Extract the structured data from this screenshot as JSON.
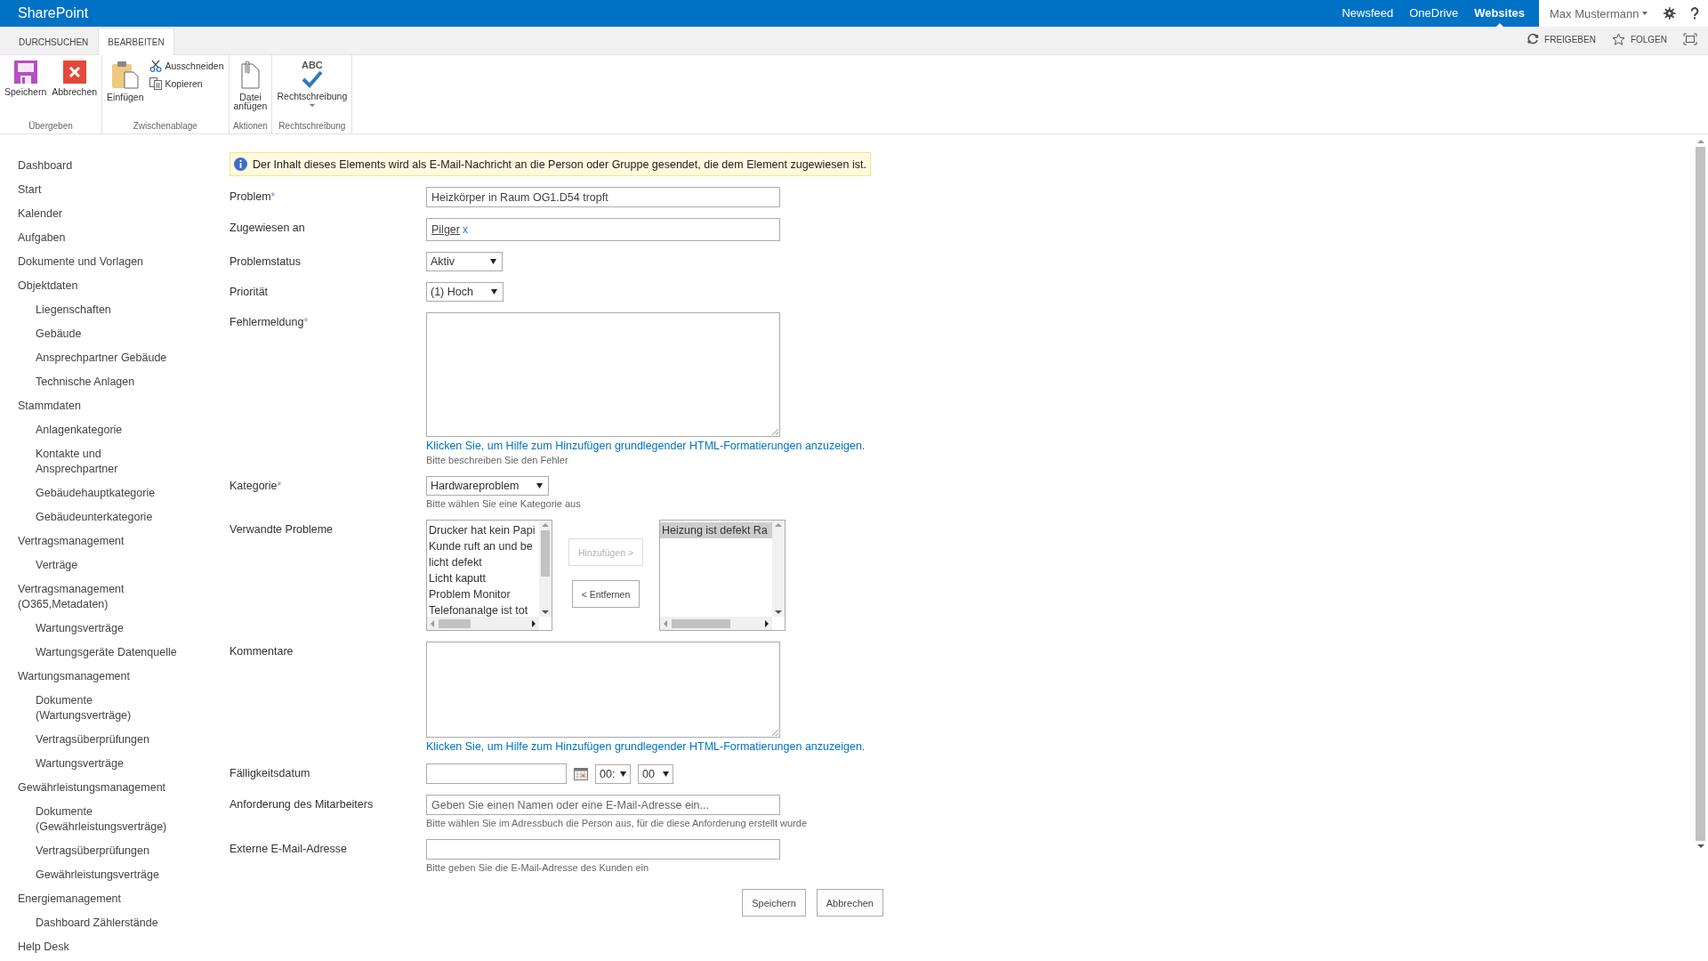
{
  "top_bar": {
    "brand": "SharePoint",
    "links": [
      {
        "label": "Newsfeed",
        "selected": false
      },
      {
        "label": "OneDrive",
        "selected": false
      },
      {
        "label": "Websites",
        "selected": true
      }
    ],
    "user": "Max Mustermann"
  },
  "ribbon": {
    "tabs": [
      {
        "label": "DURCHSUCHEN",
        "selected": false
      },
      {
        "label": "BEARBEITEN",
        "selected": true
      }
    ],
    "actions": [
      {
        "label": "FREIGEBEN",
        "kind": "share"
      },
      {
        "label": "FOLGEN",
        "kind": "follow"
      }
    ],
    "groups": [
      {
        "label": "Übergeben",
        "commands": [
          {
            "label": "Speichern",
            "kind": "save"
          },
          {
            "label": "Abbrechen",
            "kind": "cancel"
          }
        ]
      },
      {
        "label": "Zwischenablage",
        "commands": [
          {
            "label": "Einfügen",
            "kind": "paste"
          },
          {
            "label": "Ausschneiden",
            "kind": "cut"
          },
          {
            "label": "Kopieren",
            "kind": "copy"
          }
        ]
      },
      {
        "label": "Aktionen",
        "commands": [
          {
            "label": "Datei\nanfügen",
            "kind": "attach"
          }
        ]
      },
      {
        "label": "Rechtschreibung",
        "commands": [
          {
            "label": "Rechtschreibung",
            "kind": "spell",
            "icon_text": "ABC"
          }
        ]
      }
    ]
  },
  "nav": [
    {
      "label": "Dashboard"
    },
    {
      "label": "Start"
    },
    {
      "label": "Kalender"
    },
    {
      "label": "Aufgaben"
    },
    {
      "label": "Dokumente und Vorlagen"
    },
    {
      "label": "Objektdaten",
      "children": [
        {
          "label": "Liegenschaften"
        },
        {
          "label": "Gebäude"
        },
        {
          "label": "Ansprechpartner Gebäude"
        },
        {
          "label": "Technische Anlagen"
        }
      ]
    },
    {
      "label": "Stammdaten",
      "children": [
        {
          "label": "Anlagenkategorie"
        },
        {
          "label": "Kontakte und\nAnsprechpartner"
        },
        {
          "label": "Gebäudehauptkategorie"
        },
        {
          "label": "Gebäudeunterkategorie"
        }
      ]
    },
    {
      "label": "Vertragsmanagement",
      "children": [
        {
          "label": "Verträge"
        }
      ]
    },
    {
      "label": "Vertragsmanagement\n(O365,Metadaten)",
      "children": [
        {
          "label": "Wartungsverträge"
        },
        {
          "label": "Wartungsgeräte Datenquelle"
        }
      ]
    },
    {
      "label": "Wartungsmanagement",
      "children": [
        {
          "label": "Dokumente\n(Wartungsverträge)"
        },
        {
          "label": "Vertragsüberprüfungen"
        },
        {
          "label": "Wartungsverträge"
        }
      ]
    },
    {
      "label": "Gewährleistungsmanagement",
      "children": [
        {
          "label": "Dokumente\n(Gewährleistungsverträge)"
        },
        {
          "label": "Vertragsüberprüfungen"
        },
        {
          "label": "Gewährleistungsverträge"
        }
      ]
    },
    {
      "label": "Energiemanagement",
      "children": [
        {
          "label": "Dashboard Zählerstände"
        }
      ]
    },
    {
      "label": "Help Desk"
    }
  ],
  "info": "Der Inhalt dieses Elements wird als E-Mail-Nachricht an die Person oder Gruppe gesendet, die dem Element zugewiesen ist.",
  "fields": [
    {
      "label": "Problem",
      "required_mark": "*",
      "kind": "text",
      "value": "Heizkörper in Raum OG1.D54 tropft"
    },
    {
      "label": "Zugewiesen an",
      "kind": "people",
      "value": "Pilger",
      "remove": "x"
    },
    {
      "label": "Problemstatus",
      "kind": "select",
      "value": "Aktiv"
    },
    {
      "label": "Priorität",
      "kind": "select",
      "value": "(1) Hoch"
    },
    {
      "label": "Fehlermeldung",
      "required_mark": "*",
      "kind": "textarea",
      "link": "Klicken Sie, um Hilfe zum Hinzufügen grundlegender HTML-Formatierungen anzuzeigen.",
      "hint": "Bitte beschreiben Sie den Fehler"
    },
    {
      "label": "Kategorie",
      "required_mark": "*",
      "kind": "select",
      "value": "Hardwareproblem",
      "hint": "Bitte wählen Sie eine Kategorie aus"
    },
    {
      "label": "Verwandte Probleme",
      "kind": "multi",
      "available": [
        "Drucker hat kein Papi",
        "Kunde ruft an und be",
        "licht defekt",
        "Licht kaputt",
        "Problem Monitor",
        "Telefonanalge ist tot"
      ],
      "chosen": [
        {
          "label": "Heizung ist defekt Ra",
          "selected": true
        }
      ],
      "add": {
        "label": "Hinzufügen >",
        "disabled": true
      },
      "remove_button": {
        "label": "< Entfernen",
        "disabled": false
      }
    },
    {
      "label": "Kommentare",
      "kind": "textarea",
      "link": "Klicken Sie, um Hilfe zum Hinzufügen grundlegender HTML-Formatierungen anzuzeigen."
    },
    {
      "label": "Fälligkeitsdatum",
      "kind": "datetime",
      "hour": "00:",
      "minute": "00"
    },
    {
      "label": "Anforderung des Mitarbeiters",
      "kind": "text",
      "placeholder": "Geben Sie einen Namen oder eine E-Mail-Adresse ein...",
      "hint": "Bitte wählen Sie im Adressbuch die Person aus, für die diese Anforderung erstellt wurde"
    },
    {
      "label": "Externe E-Mail-Adresse",
      "kind": "text",
      "hint": "Bitte geben Sie die E-Mail-Adresse des Kunden ein"
    }
  ],
  "buttons": [
    "Speichern",
    "Abbrechen"
  ]
}
